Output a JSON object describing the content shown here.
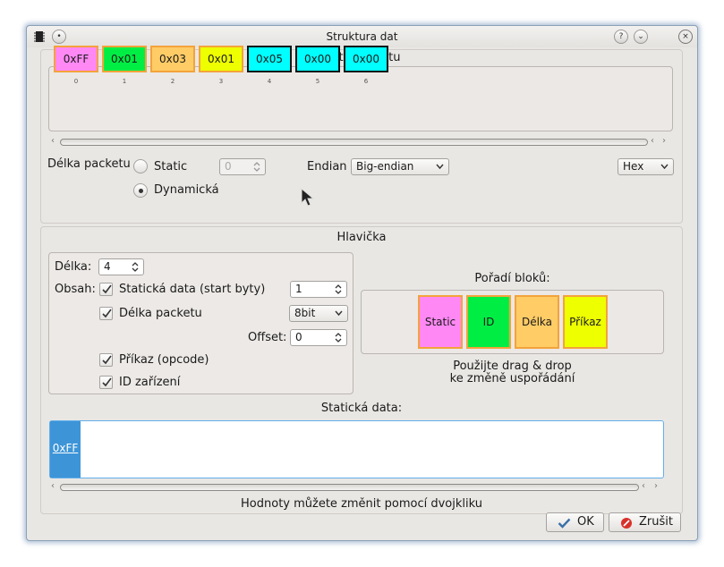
{
  "window": {
    "title": "Struktura dat"
  },
  "titlebar": {
    "help_glyph": "?",
    "minimize_glyph": "⌄",
    "close_glyph": "×"
  },
  "packet": {
    "section_title": "Data packetu",
    "bytes": [
      {
        "value": "0xFF",
        "index": "0",
        "color": "#ff88f4",
        "border": "#f3a33b"
      },
      {
        "value": "0x01",
        "index": "1",
        "color": "#00ee44",
        "border": "#f3a33b"
      },
      {
        "value": "0x03",
        "index": "2",
        "color": "#ffcc66",
        "border": "#f3a33b"
      },
      {
        "value": "0x01",
        "index": "3",
        "color": "#eeff00",
        "border": "#f3a33b"
      },
      {
        "value": "0x05",
        "index": "4",
        "color": "#00ffff",
        "border": "#111111"
      },
      {
        "value": "0x00",
        "index": "5",
        "color": "#00ffff",
        "border": "#111111"
      },
      {
        "value": "0x00",
        "index": "6",
        "color": "#00ffff",
        "border": "#111111"
      }
    ]
  },
  "length": {
    "label": "Délka packetu",
    "static_label": "Static",
    "static_value": "0",
    "dynamic_label": "Dynamická",
    "selected": "Dynamická"
  },
  "endian": {
    "label": "Endian",
    "value": "Big-endian"
  },
  "format": {
    "value": "Hex"
  },
  "header": {
    "section_title": "Hlavička",
    "length_label": "Délka:",
    "length_value": "4",
    "content_label": "Obsah:",
    "static_data_label": "Statická data (start byty)",
    "static_data_value": "1",
    "packet_length_label": "Délka packetu",
    "packet_length_bits": "8bit",
    "offset_label": "Offset:",
    "offset_value": "0",
    "opcode_label": "Příkaz (opcode)",
    "device_id_label": "ID zařízení"
  },
  "order": {
    "title": "Pořadí bloků:",
    "blocks": [
      {
        "label": "Static",
        "color": "#ff88f4"
      },
      {
        "label": "ID",
        "color": "#00ee44"
      },
      {
        "label": "Délka",
        "color": "#ffcc66"
      },
      {
        "label": "Příkaz",
        "color": "#eeff00"
      }
    ],
    "hint_line1": "Použijte drag & drop",
    "hint_line2": "ke změně uspořádání"
  },
  "static_data": {
    "section_title": "Statická data:",
    "cell": "0xFF",
    "hint": "Hodnoty můžete změnit pomocí dvojkliku"
  },
  "buttons": {
    "ok": "OK",
    "cancel": "Zrušit"
  },
  "colors": {
    "accent": "#3d95d8",
    "focus_border": "#62aee8"
  }
}
